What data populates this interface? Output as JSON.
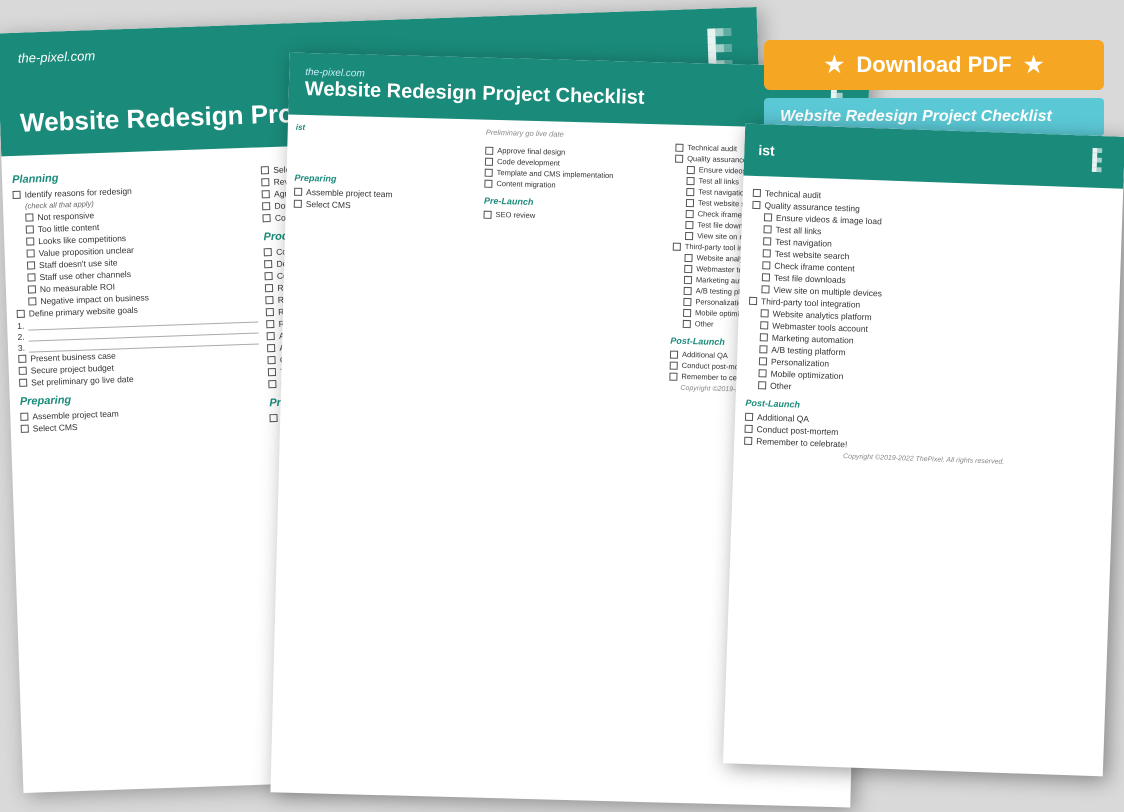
{
  "colors": {
    "teal": "#1a8a7a",
    "light_teal": "#5bc8d5",
    "orange": "#f5a623",
    "white": "#ffffff",
    "dark_text": "#333333"
  },
  "download_btn": {
    "label": "★ Download PDF ★",
    "subtitle": "Website Redesign Project Checklist"
  },
  "main_doc": {
    "title": "Website Redesign Project Checklist",
    "site": "the-pixel.com",
    "sections": {
      "planning": {
        "title": "Planning",
        "items": [
          "Identify reasons for redesign",
          "(check all that apply)",
          "Not responsive",
          "Too little content",
          "Looks like competitions",
          "Value proposition unclear",
          "Staff doesn't use site",
          "Staff use other channels",
          "No measurable ROI",
          "Negative impact on business",
          "Define primary website goals",
          "1.",
          "2.",
          "3.",
          "Present business case",
          "Secure project budget",
          "Set preliminary go live date"
        ]
      },
      "preparing": {
        "title": "Preparing",
        "items": [
          "Assemble project team",
          "Select CMS"
        ]
      },
      "col2": {
        "items": [
          "Select design partner or team",
          "Review statement of work",
          "Agree on project timeline",
          "Document content strategy",
          "Conduct a content audit"
        ]
      },
      "production": {
        "title": "Production",
        "items": [
          "Content development",
          "Define information architecture",
          "Complete discovery phase",
          "Review wireframes",
          "Review art direction",
          "Review design round 1",
          "Review design round 2",
          "Additional review if needed",
          "Approve final design",
          "Code development",
          "Template and CMS implementation",
          "Content migration"
        ]
      },
      "pre_launch": {
        "title": "Pre-Launch",
        "items": [
          "SEO review"
        ]
      },
      "col3": {
        "items": [
          "Technical audit",
          "Quality assurance testing",
          "Ensure videos & image load",
          "Test all links",
          "Test navigation",
          "Test website search",
          "Check iframe content",
          "Test file downloads",
          "View site on multiple devices",
          "Third-party tool integration",
          "Website analytics platform",
          "Webmaster tools account",
          "Marketing automation",
          "A/B testing platform",
          "Personalization",
          "Mobile optimization",
          "Other"
        ]
      },
      "post_launch": {
        "title": "Post-Launch",
        "items": [
          "Additional QA",
          "Conduct post-mortem",
          "Remember to celebrate!"
        ]
      }
    }
  },
  "copyright": "Copyright ©2019-2022 ThePixel. All rights reserved."
}
